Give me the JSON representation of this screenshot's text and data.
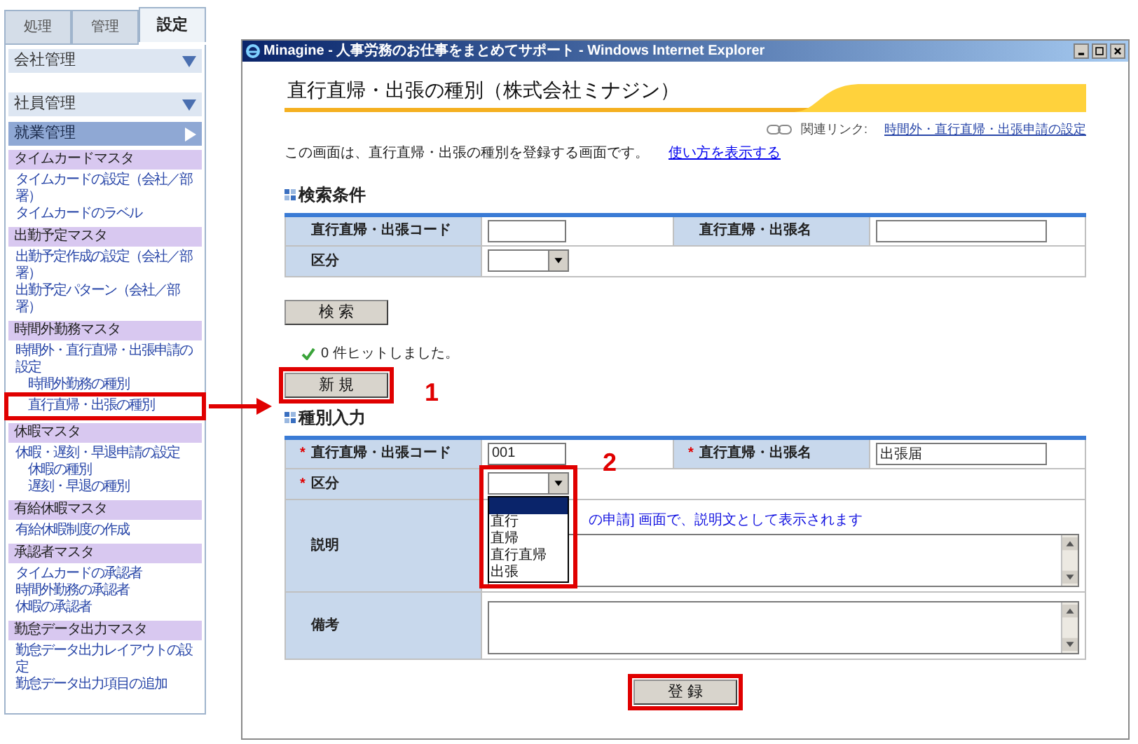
{
  "sidebar": {
    "tabs": [
      {
        "label": "処理",
        "selected": false
      },
      {
        "label": "管理",
        "selected": false
      },
      {
        "label": "設定",
        "selected": true
      }
    ],
    "menus": [
      {
        "label": "会社管理",
        "expanded": false
      },
      {
        "label": "社員管理",
        "expanded": false
      },
      {
        "label": "就業管理",
        "expanded": true
      }
    ],
    "sections": [
      {
        "title": "タイムカードマスタ",
        "items": [
          {
            "label": "タイムカードの設定（会社／部署）",
            "highlighted": false
          },
          {
            "label": "タイムカードのラベル",
            "highlighted": false
          }
        ]
      },
      {
        "title": "出勤予定マスタ",
        "items": [
          {
            "label": "出勤予定作成の設定（会社／部署）",
            "highlighted": false
          },
          {
            "label": "出勤予定パターン（会社／部署）",
            "highlighted": false
          }
        ]
      },
      {
        "title": "時間外勤務マスタ",
        "items": [
          {
            "label": "時間外・直行直帰・出張申請の設定",
            "highlighted": false,
            "children": [
              {
                "label": "時間外勤務の種別",
                "highlighted": false
              },
              {
                "label": "直行直帰・出張の種別",
                "highlighted": true
              }
            ]
          }
        ]
      },
      {
        "title": "休暇マスタ",
        "items": [
          {
            "label": "休暇・遅刻・早退申請の設定",
            "highlighted": false,
            "children": [
              {
                "label": "休暇の種別",
                "highlighted": false
              },
              {
                "label": "遅刻・早退の種別",
                "highlighted": false
              }
            ]
          }
        ]
      },
      {
        "title": "有給休暇マスタ",
        "items": [
          {
            "label": "有給休暇制度の作成",
            "highlighted": false
          }
        ]
      },
      {
        "title": "承認者マスタ",
        "items": [
          {
            "label": "タイムカードの承認者",
            "highlighted": false
          },
          {
            "label": "時間外勤務の承認者",
            "highlighted": false
          },
          {
            "label": "休暇の承認者",
            "highlighted": false
          }
        ]
      },
      {
        "title": "勤怠データ出力マスタ",
        "items": [
          {
            "label": "勤怠データ出力レイアウトの設定",
            "highlighted": false
          },
          {
            "label": "勤怠データ出力項目の追加",
            "highlighted": false
          }
        ]
      }
    ]
  },
  "window": {
    "title": "Minagine - 人事労務のお仕事をまとめてサポート - Windows Internet Explorer"
  },
  "page": {
    "heading": "直行直帰・出張の種別（株式会社ミナジン）",
    "related_label": "関連リンク:",
    "related_link": "時間外・直行直帰・出張申請の設定",
    "intro": "この画面は、直行直帰・出張の種別を登録する画面です。",
    "help_link": "使い方を表示する"
  },
  "search": {
    "title": "検索条件",
    "code_label": "直行直帰・出張コード",
    "name_label": "直行直帰・出張名",
    "category_label": "区分",
    "button": "検 索",
    "result": "0 件ヒットしました。"
  },
  "new_button": {
    "label": "新 規",
    "highlighted": true,
    "callout": "1"
  },
  "entry": {
    "title": "種別入力",
    "code_label": "直行直帰・出張コード",
    "code_value": "001",
    "name_label": "直行直帰・出張名",
    "name_value": "出張届",
    "category_label": "区分",
    "required_mark": "*",
    "category_options": [
      {
        "selected": true
      },
      {
        "label": "直行",
        "selected": false
      },
      {
        "label": "直帰",
        "selected": false
      },
      {
        "label": "直行直帰",
        "selected": false
      },
      {
        "label": "出張",
        "selected": false
      }
    ],
    "category_callout": "2",
    "category_highlighted": true,
    "description_label": "説明",
    "description_hint": "の申請] 画面で、説明文として表示されます",
    "notes_label": "備考"
  },
  "submit_button": {
    "label": "登 録",
    "highlighted": true
  }
}
